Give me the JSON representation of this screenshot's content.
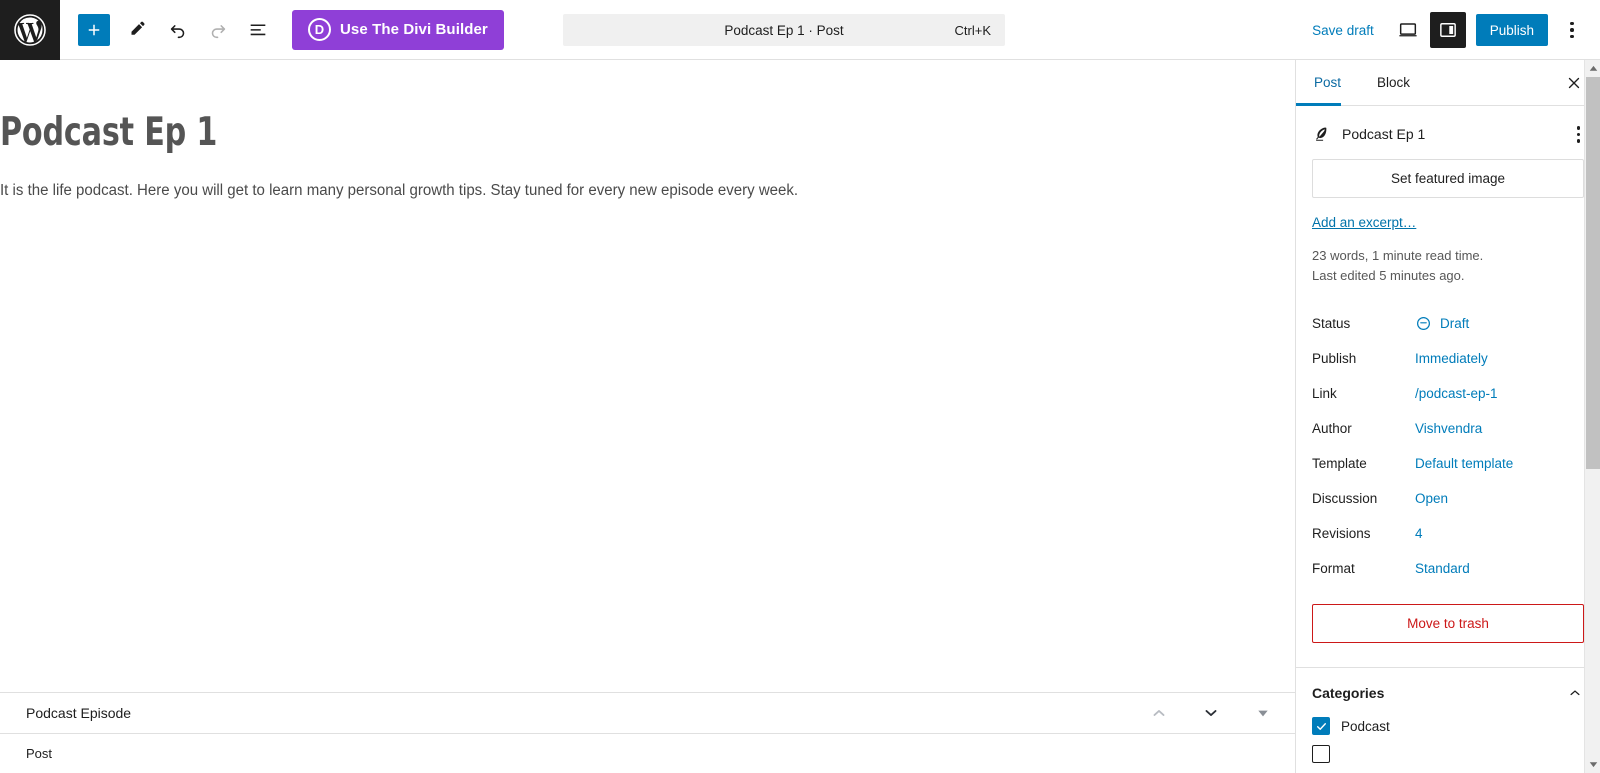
{
  "topbar": {
    "wordpress_logo_icon": "wordpress-logo",
    "add_block_label": "+",
    "tools_icon": "pencil-icon",
    "undo_icon": "undo-arrow-icon",
    "redo_icon": "redo-arrow-icon",
    "list_view_icon": "document-overview-icon",
    "divi_button_label": "Use The Divi Builder",
    "divi_badge_letter": "D",
    "divi_color": "#8f3fd7",
    "command_title": "Podcast Ep 1 · Post",
    "command_shortcut": "Ctrl+K",
    "save_draft_label": "Save draft",
    "preview_icon": "desktop-preview-icon",
    "sidebar_toggle_icon": "settings-panel-icon",
    "publish_label": "Publish",
    "options_icon": "kebab-menu-icon",
    "accent_color": "#007cba"
  },
  "editor": {
    "title": "Podcast Ep 1",
    "paragraph": "It is the life podcast. Here you will get to learn many personal growth tips. Stay tuned for every new episode every week.",
    "grammarly": {
      "assistant_icon": "lightbulb-icon",
      "logo_icon": "grammarly-g-icon",
      "brand_color": "#15a88a"
    }
  },
  "block_bar": {
    "block_name": "Podcast Episode",
    "move_up_icon": "chevron-up-icon",
    "move_down_icon": "chevron-down-icon",
    "more_icon": "caret-down-icon"
  },
  "breadcrumb": {
    "items": [
      "Post"
    ]
  },
  "sidebar": {
    "tabs": [
      {
        "label": "Post",
        "active": true
      },
      {
        "label": "Block",
        "active": false
      }
    ],
    "close_icon": "close-x-icon",
    "document": {
      "icon": "quill-pen-icon",
      "title": "Podcast Ep 1",
      "actions_icon": "kebab-menu-icon"
    },
    "featured_image_label": "Set featured image",
    "excerpt_link": "Add an excerpt…",
    "word_count_note": "23 words, 1 minute read time.",
    "last_edited_note": "Last edited 5 minutes ago.",
    "meta_rows": [
      {
        "label": "Status",
        "value": "Draft",
        "icon": "draft-status-icon"
      },
      {
        "label": "Publish",
        "value": "Immediately",
        "icon": ""
      },
      {
        "label": "Link",
        "value": "/podcast-ep-1",
        "icon": ""
      },
      {
        "label": "Author",
        "value": "Vishvendra",
        "icon": ""
      },
      {
        "label": "Template",
        "value": "Default template",
        "icon": ""
      },
      {
        "label": "Discussion",
        "value": "Open",
        "icon": ""
      },
      {
        "label": "Revisions",
        "value": "4",
        "icon": ""
      },
      {
        "label": "Format",
        "value": "Standard",
        "icon": ""
      }
    ],
    "trash_label": "Move to trash",
    "trash_color": "#cc1818",
    "categories": {
      "title": "Categories",
      "collapse_icon": "chevron-up-icon",
      "items": [
        {
          "label": "Podcast",
          "checked": true
        }
      ]
    },
    "scrollbar": {
      "up_icon": "scroll-up-arrow",
      "down_icon": "scroll-down-arrow"
    }
  }
}
